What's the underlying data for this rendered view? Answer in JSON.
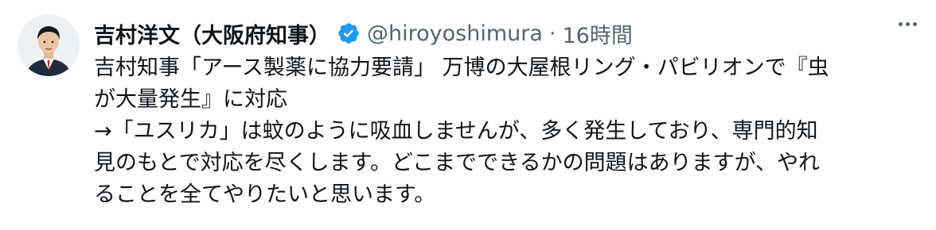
{
  "tweet": {
    "author": {
      "display_name": "吉村洋文（大阪府知事）",
      "handle": "@hiroyoshimura",
      "verified_icon": "verified-badge-icon",
      "verified_color": "#1d9bf0"
    },
    "separator": "·",
    "timestamp": "16時間",
    "more_icon": "more-options-icon",
    "body_lines": [
      "吉村知事「アース製薬に協力要請」 万博の大屋根リング・パビリオンで『虫",
      "が大量発生』に対応",
      "→「ユスリカ」は蚊のように吸血しませんが、多く発生しており、専門的知",
      "見のもとで対応を尽くします。どこまでできるかの問題はありますが、やれ",
      "ることを全てやりたいと思います。"
    ]
  }
}
